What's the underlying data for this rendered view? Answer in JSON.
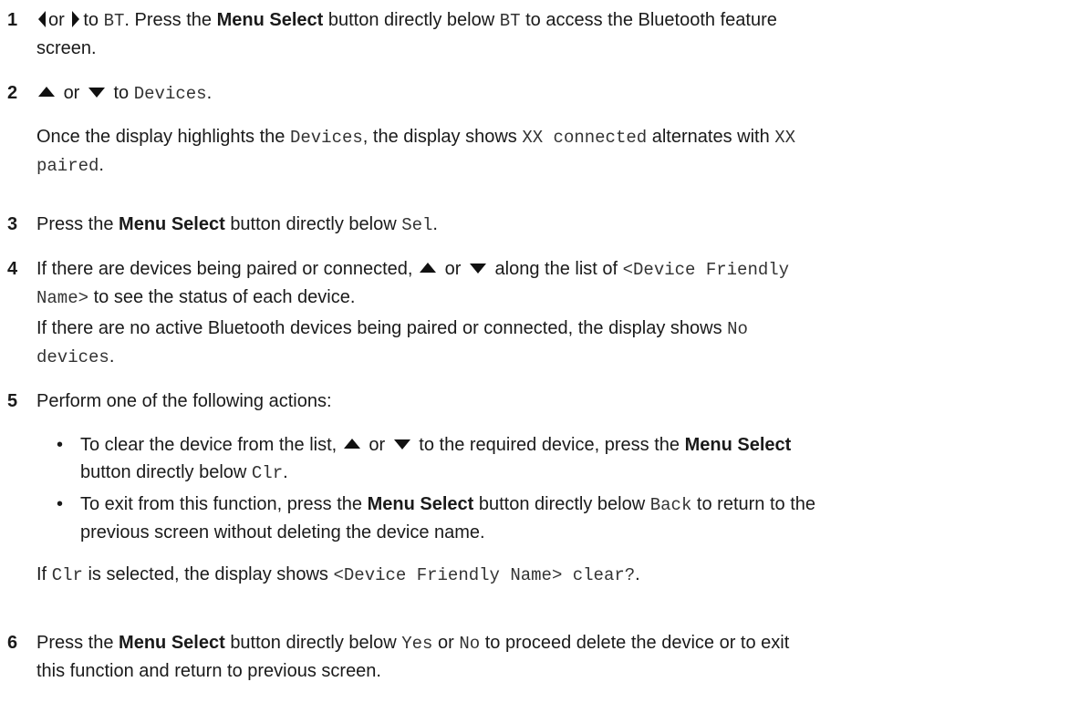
{
  "steps": {
    "s1": {
      "num": "1",
      "or": "or",
      "to": "to",
      "bt": "BT",
      "a": ". Press the",
      "menu_select": "Menu Select",
      "b": "button directly below",
      "c": "to access the Bluetooth feature",
      "d": "screen."
    },
    "s2": {
      "num": "2",
      "or": "or",
      "to": "to",
      "devices": "Devices",
      "dot": ".",
      "p1": "Once the display highlights the",
      "p2": ", the display shows",
      "xx_connected": "XX connected",
      "p3": "alternates with",
      "xx": "XX",
      "paired": "paired",
      "p4": "."
    },
    "s3": {
      "num": "3",
      "a": "Press the",
      "menu_select": "Menu Select",
      "b": "button directly below",
      "sel": "Sel",
      "c": "."
    },
    "s4": {
      "num": "4",
      "a": "If there are devices being paired or connected,",
      "or": "or",
      "b": "along the list of",
      "dfn1": "<Device Friendly",
      "dfn2": "Name>",
      "c": "to see the status of each device.",
      "p1": "If there are no active Bluetooth devices being paired or connected, the display shows",
      "no": "No",
      "devices": "devices",
      "p2": "."
    },
    "s5": {
      "num": "5",
      "intro": "Perform one of the following actions:",
      "bullet": "•",
      "b1a": "To clear the device from the list,",
      "or": "or",
      "b1b": "to the required device, press the",
      "menu_select": "Menu Select",
      "b1c": "button directly below",
      "clr": "Clr",
      "dot": ".",
      "b2a": "To exit from this function, press the",
      "b2b": "button directly below",
      "back": "Back",
      "b2c": "to return to the",
      "b2d": "previous screen without deleting the device name.",
      "if1": "If",
      "if2": "is selected, the display shows",
      "clear_q": "<Device Friendly Name> clear?",
      "if3": "."
    },
    "s6": {
      "num": "6",
      "a": "Press the",
      "menu_select": "Menu Select",
      "b": "button directly below",
      "yes": "Yes",
      "or": "or",
      "no": "No",
      "c": "to proceed delete the device or to exit",
      "d": "this function and return to previous screen."
    }
  }
}
